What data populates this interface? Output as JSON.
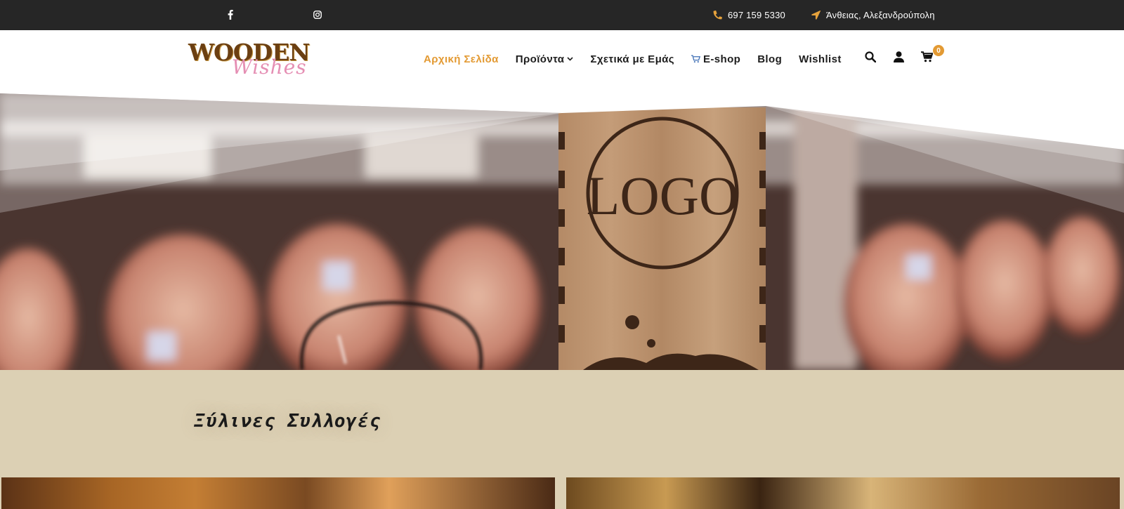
{
  "topbar": {
    "social": [
      {
        "name": "facebook-icon"
      },
      {
        "name": "instagram-icon"
      }
    ],
    "phone": "697 159 5330",
    "address": "Άνθειας, Αλεξανδρούπολη",
    "accent": "#e6a23c"
  },
  "header": {
    "logo_word_1": "WOODEN",
    "logo_word_2": "Wishes",
    "nav": [
      {
        "label": "Αρχική Σελίδα",
        "active": true
      },
      {
        "label": "Προϊόντα",
        "dropdown": true
      },
      {
        "label": "Σχετικά με Εμάς"
      },
      {
        "label": "E-shop",
        "icon": "cart-icon"
      },
      {
        "label": "Blog"
      },
      {
        "label": "Wishlist"
      }
    ],
    "icons": [
      "search-icon",
      "user-icon",
      "cart-icon"
    ],
    "cart_count": "0",
    "accent": "#e39a33"
  },
  "hero": {
    "box_engraving": "LOGO"
  },
  "collections": {
    "title": "Ξύλινες Συλλογές",
    "background": "#dcd0b4"
  }
}
